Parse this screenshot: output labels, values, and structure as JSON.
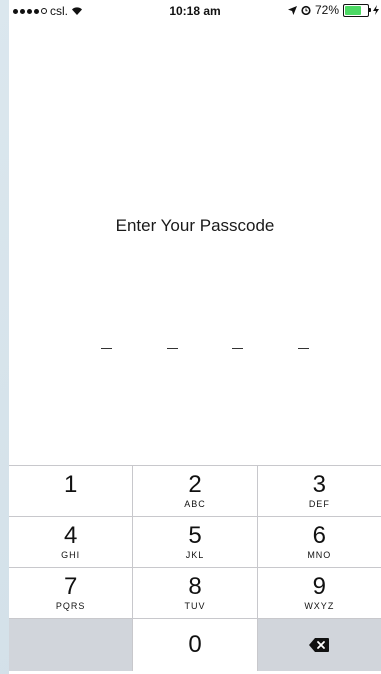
{
  "status_bar": {
    "carrier": "csl.",
    "time": "10:18 am",
    "battery_percent": "72%",
    "battery_level": 0.72,
    "signal_bars_filled": 4,
    "signal_bars_total": 5
  },
  "title": "Enter Your Passcode",
  "passcode_length": 4,
  "keypad": {
    "rows": [
      [
        {
          "digit": "1",
          "letters": ""
        },
        {
          "digit": "2",
          "letters": "ABC"
        },
        {
          "digit": "3",
          "letters": "DEF"
        }
      ],
      [
        {
          "digit": "4",
          "letters": "GHI"
        },
        {
          "digit": "5",
          "letters": "JKL"
        },
        {
          "digit": "6",
          "letters": "MNO"
        }
      ],
      [
        {
          "digit": "7",
          "letters": "PQRS"
        },
        {
          "digit": "8",
          "letters": "TUV"
        },
        {
          "digit": "9",
          "letters": "WXYZ"
        }
      ]
    ],
    "zero": "0",
    "delete_icon": "backspace-icon"
  },
  "colors": {
    "battery": "#4cd964",
    "keypad_gray": "#d1d5db"
  }
}
